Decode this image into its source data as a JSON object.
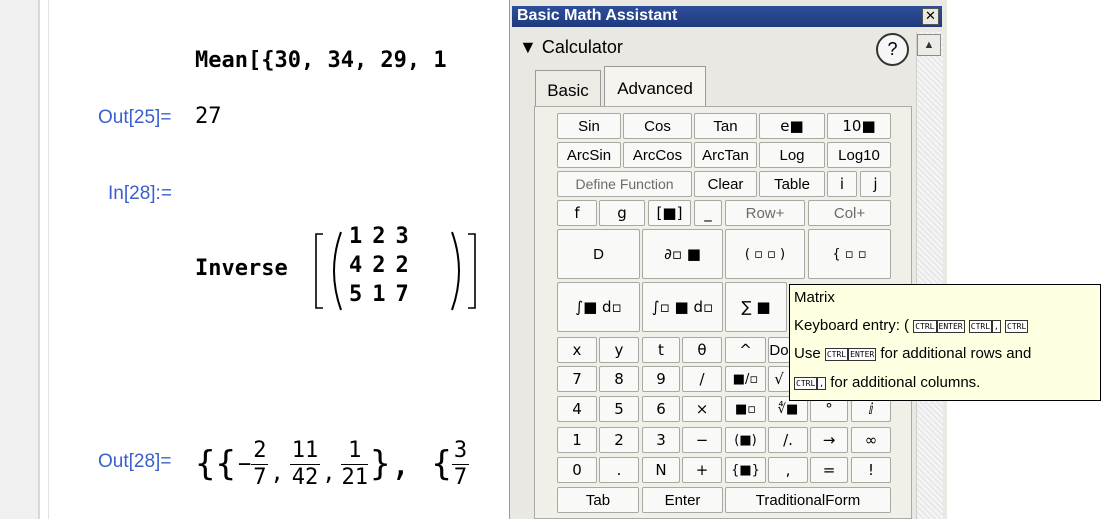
{
  "notebook": {
    "mean_input": "Mean[{30, 34, 29, 1",
    "out25_label": "Out[25]=",
    "out25_value": "27",
    "in28_label": "In[28]:=",
    "inverse_fn": "Inverse",
    "matrix": [
      [
        "1",
        "2",
        "3"
      ],
      [
        "4",
        "2",
        "2"
      ],
      [
        "5",
        "1",
        "7"
      ]
    ],
    "out28_label": "Out[28]=",
    "out28": {
      "open": "{{",
      "minus": "−",
      "f1_num": "2",
      "f1_den": "7",
      "f2_num": "11",
      "f2_den": "42",
      "f3_num": "1",
      "f3_den": "21",
      "close_open": "}, {",
      "f4_num": "3",
      "f4_den": "7"
    }
  },
  "palette": {
    "title": "Basic Math Assistant",
    "close_label": "✕",
    "section": "▼ Calculator",
    "help_label": "?",
    "scroll_up": "▲",
    "tabs": [
      {
        "label": "Basic"
      },
      {
        "label": "Advanced"
      }
    ],
    "buttons": {
      "sin": "Sin",
      "cos": "Cos",
      "tan": "Tan",
      "e_pow": "e■",
      "ten_pow": "10■",
      "arcsin": "ArcSin",
      "arccos": "ArcCos",
      "arctan": "ArcTan",
      "log": "Log",
      "log10": "Log10",
      "define_function": "Define Function",
      "clear": "Clear",
      "table": "Table",
      "i": "i",
      "j": "j",
      "f": "f",
      "g": "g",
      "bracket": "[■]",
      "underscore": "_",
      "row_plus": "Row+",
      "col_plus": "Col+",
      "d": "D",
      "partial": "∂▫ ■",
      "matrix": "( ▫ ▫ )",
      "piecewise": "{ ▫ ▫",
      "integral": "∫■ d▫",
      "def_integral": "∫▫ ■ d▫",
      "sum": "∑ ■",
      "x": "x",
      "y": "y",
      "t": "t",
      "theta": "θ",
      "caret": "^",
      "do": "Do",
      "seven": "7",
      "eight": "8",
      "nine": "9",
      "slash": "/",
      "frac": "■/▫",
      "sqrt": "√",
      "four": "4",
      "five": "5",
      "six": "6",
      "times": "×",
      "square": "■▫",
      "nthroot": "∜■",
      "degree": "°",
      "imag": "ⅈ",
      "one": "1",
      "two": "2",
      "three": "3",
      "minus": "−",
      "paren": "(■)",
      "replace": "/.",
      "arrow": "→",
      "infinity": "∞",
      "zero": "0",
      "dot": ".",
      "n": "N",
      "plus": "+",
      "braces": "{■}",
      "comma": ",",
      "equals": "=",
      "bang": "!",
      "tab": "Tab",
      "enter": "Enter",
      "traditional_form": "TraditionalForm"
    },
    "tooltip": {
      "title": "Matrix",
      "line1": "Keyboard entry: (",
      "line2a": "Use",
      "line2b": "for additional rows and",
      "line3b": "for additional columns.",
      "key_ctrl": "CTRL",
      "key_enter": "ENTER",
      "key_comma": ","
    }
  }
}
